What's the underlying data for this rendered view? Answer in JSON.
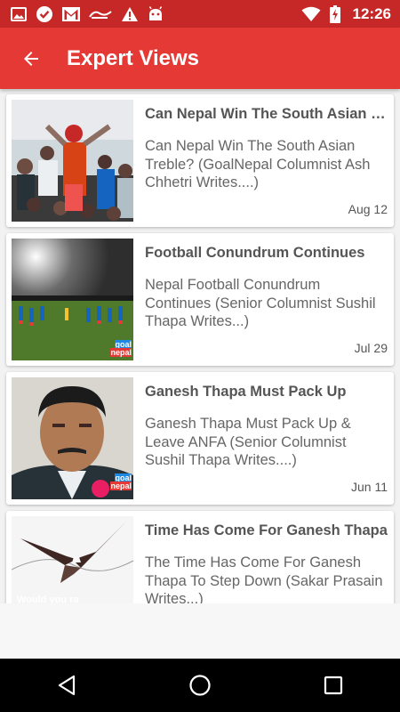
{
  "status_bar": {
    "time": "12:26",
    "icons": [
      "image-icon",
      "check-icon",
      "gmail-icon",
      "app-logo-icon",
      "warning-icon",
      "android-icon",
      "wifi-icon",
      "battery-charging-icon"
    ],
    "color": "#c62828"
  },
  "app_bar": {
    "title": "Expert Views",
    "back_icon": "arrow-back-icon",
    "color": "#e53935"
  },
  "articles": [
    {
      "title": "Can Nepal Win The South Asian Treble?",
      "description": "Can Nepal Win The South Asian Treble?  (GoalNepal Columnist Ash Chhetri Writes....)",
      "date": "Aug 12"
    },
    {
      "title": "Football Conundrum Continues",
      "description": "Nepal Football Conundrum Continues (Senior Columnist Sushil Thapa Writes...)",
      "date": "Jul 29",
      "watermark": "goal nepal"
    },
    {
      "title": "Ganesh Thapa Must Pack Up",
      "description": "Ganesh Thapa Must Pack Up & Leave ANFA  (Senior Columnist Sushil Thapa Writes....)",
      "date": "Jun 11",
      "watermark": "goal nepal"
    },
    {
      "title": "Time Has Come For Ganesh Thapa",
      "description": "The Time Has Come For Ganesh Thapa To Step Down (Sakar Prasain Writes...)",
      "date": "",
      "image_caption": "Would you ra"
    }
  ],
  "nav_bar": {
    "buttons": [
      "back-triangle-icon",
      "home-circle-icon",
      "recents-square-icon"
    ]
  }
}
